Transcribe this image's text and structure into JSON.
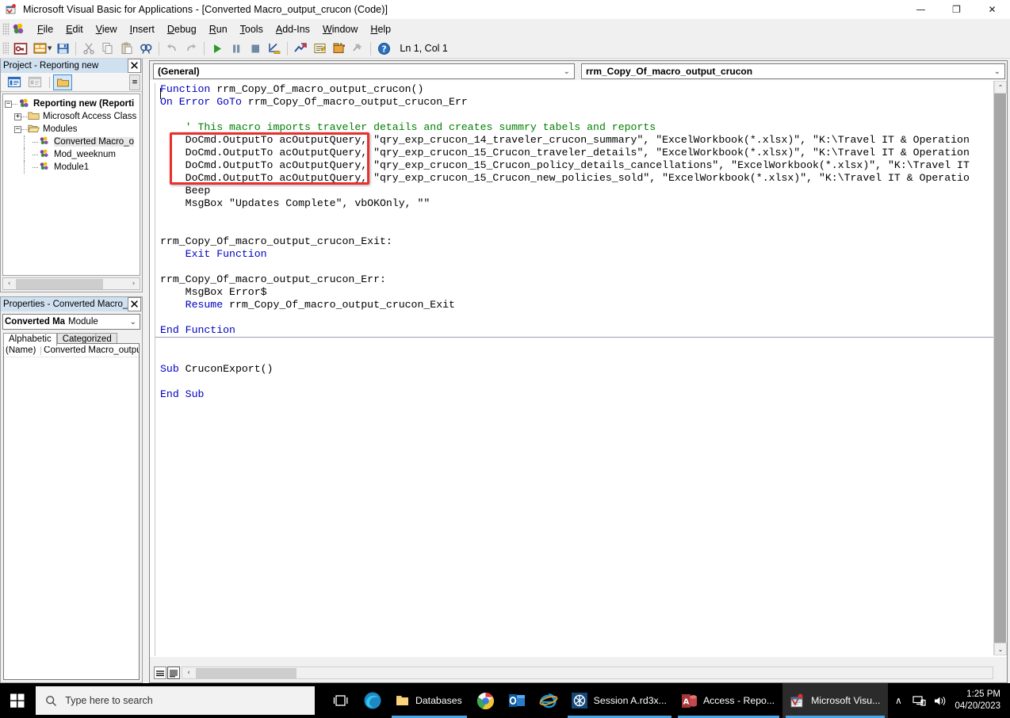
{
  "window": {
    "title": "Microsoft Visual Basic for Applications - [Converted Macro_output_crucon (Code)]",
    "app_icon": "vba-icon",
    "minimize": "—",
    "restore": "❐",
    "close": "✕"
  },
  "mdi": {
    "minimize": "–",
    "restore": "❐",
    "close": "✕"
  },
  "menu": {
    "items": [
      {
        "label": "File",
        "accel": "F"
      },
      {
        "label": "Edit",
        "accel": "E"
      },
      {
        "label": "View",
        "accel": "V"
      },
      {
        "label": "Insert",
        "accel": "I"
      },
      {
        "label": "Debug",
        "accel": "D"
      },
      {
        "label": "Run",
        "accel": "R"
      },
      {
        "label": "Tools",
        "accel": "T"
      },
      {
        "label": "Add-Ins",
        "accel": "A"
      },
      {
        "label": "Window",
        "accel": "W"
      },
      {
        "label": "Help",
        "accel": "H"
      }
    ]
  },
  "toolbar": {
    "buttons": [
      "view-microsoft-access-icon",
      "insert-module-icon",
      "insert-module-dropdown-icon",
      "save-icon",
      "cut-icon",
      "copy-icon",
      "paste-icon",
      "find-icon",
      "undo-icon",
      "redo-icon",
      "run-icon",
      "break-icon",
      "reset-icon",
      "design-mode-icon",
      "project-explorer-icon",
      "properties-window-icon",
      "object-browser-icon",
      "toolbox-icon",
      "help-icon"
    ],
    "status": "Ln 1, Col 1"
  },
  "project_panel": {
    "title": "Project - Reporting new",
    "close_label": "✕",
    "toolbar_buttons": [
      "view-code-icon",
      "view-object-icon",
      "toggle-folders-icon"
    ],
    "overflow_label": "≡",
    "tree": [
      {
        "label": "Reporting new (Reporti",
        "expander": "−",
        "icon": "vba-project-icon",
        "depth": 0,
        "bold": true,
        "selected": false
      },
      {
        "label": "Microsoft Access Class (",
        "expander": "+",
        "icon": "folder-icon",
        "depth": 1,
        "bold": false,
        "selected": false
      },
      {
        "label": "Modules",
        "expander": "−",
        "icon": "open-folder-icon",
        "depth": 1,
        "bold": false,
        "selected": false
      },
      {
        "label": "Converted Macro_o",
        "expander": "",
        "icon": "module-icon",
        "depth": 2,
        "bold": false,
        "selected": true
      },
      {
        "label": "Mod_weeknum",
        "expander": "",
        "icon": "module-icon",
        "depth": 2,
        "bold": false,
        "selected": false
      },
      {
        "label": "Module1",
        "expander": "",
        "icon": "module-icon",
        "depth": 2,
        "bold": false,
        "selected": false
      }
    ],
    "hscroll": {
      "left_arrow": "‹",
      "right_arrow": "›"
    }
  },
  "properties_panel": {
    "title": "Properties - Converted Macro_",
    "close_label": "✕",
    "object_name": "Converted Ma",
    "object_type": "Module",
    "dropdown_arrow": "⌄",
    "tabs": [
      {
        "label": "Alphabetic",
        "active": true
      },
      {
        "label": "Categorized",
        "active": false
      }
    ],
    "rows": [
      {
        "key": "(Name)",
        "value": "Converted Macro_output_"
      }
    ]
  },
  "code_window": {
    "object_combo": "(General)",
    "proc_combo": "rrm_Copy_Of_macro_output_crucon",
    "dropdown_arrow": "⌄",
    "view_buttons": [
      "procedure-view-icon",
      "full-module-view-icon"
    ],
    "hscroll": {
      "left_arrow": "‹",
      "right_arrow": "›"
    },
    "vscroll": {
      "up_arrow": "⌃",
      "down_arrow": "⌄"
    },
    "code_lines": [
      [
        {
          "t": "Function",
          "c": "kw"
        },
        {
          "t": " rrm_Copy_Of_macro_output_crucon()",
          "c": ""
        }
      ],
      [
        {
          "t": "On Error GoTo",
          "c": "kw"
        },
        {
          "t": " rrm_Copy_Of_macro_output_crucon_Err",
          "c": ""
        }
      ],
      [],
      [
        {
          "t": "    ' This macro imports traveler details and creates summry tabels and reports",
          "c": "cmt"
        }
      ],
      [
        {
          "t": "    DoCmd.OutputTo acOutputQuery, \"qry_exp_crucon_14_traveler_crucon_summary\", \"ExcelWorkbook(*.xlsx)\", \"K:\\Travel IT & Operation",
          "c": ""
        }
      ],
      [
        {
          "t": "    DoCmd.OutputTo acOutputQuery, \"qry_exp_crucon_15_Crucon_traveler_details\", \"ExcelWorkbook(*.xlsx)\", \"K:\\Travel IT & Operation",
          "c": ""
        }
      ],
      [
        {
          "t": "    DoCmd.OutputTo acOutputQuery, \"qry_exp_crucon_15_Crucon_policy_details_cancellations\", \"ExcelWorkbook(*.xlsx)\", \"K:\\Travel IT",
          "c": ""
        }
      ],
      [
        {
          "t": "    DoCmd.OutputTo acOutputQuery, \"qry_exp_crucon_15_Crucon_new_policies_sold\", \"ExcelWorkbook(*.xlsx)\", \"K:\\Travel IT & Operatio",
          "c": ""
        }
      ],
      [
        {
          "t": "    Beep",
          "c": ""
        }
      ],
      [
        {
          "t": "    MsgBox \"Updates Complete\", vbOKOnly, \"\"",
          "c": ""
        }
      ],
      [],
      [],
      [
        {
          "t": "rrm_Copy_Of_macro_output_crucon_Exit:",
          "c": ""
        }
      ],
      [
        {
          "t": "    ",
          "c": ""
        },
        {
          "t": "Exit Function",
          "c": "kw"
        }
      ],
      [],
      [
        {
          "t": "rrm_Copy_Of_macro_output_crucon_Err:",
          "c": ""
        }
      ],
      [
        {
          "t": "    MsgBox Error$",
          "c": ""
        }
      ],
      [
        {
          "t": "    ",
          "c": ""
        },
        {
          "t": "Resume",
          "c": "kw"
        },
        {
          "t": " rrm_Copy_Of_macro_output_crucon_Exit",
          "c": ""
        }
      ],
      [],
      [
        {
          "t": "End Function",
          "c": "kw"
        }
      ]
    ],
    "code_lines_2": [
      [],
      [],
      [
        {
          "t": "Sub",
          "c": "kw"
        },
        {
          "t": " CruconExport()",
          "c": ""
        }
      ],
      [],
      [
        {
          "t": "End Sub",
          "c": "kw"
        }
      ]
    ],
    "annotation": {
      "name": "red-highlight-box",
      "color": "#e8312f"
    }
  },
  "taskbar": {
    "start_label": "start-icon",
    "search_placeholder": "Type here to search",
    "search_icon": "search-icon",
    "task_view_icon": "task-view-icon",
    "pinned": [
      {
        "icon": "edge-icon",
        "label": ""
      },
      {
        "icon": "folder-icon",
        "label": "Databases"
      },
      {
        "icon": "chrome-icon",
        "label": ""
      },
      {
        "icon": "outlook-icon",
        "label": ""
      },
      {
        "icon": "internet-explorer-icon",
        "label": ""
      }
    ],
    "windows": [
      {
        "icon": "citrix-icon",
        "label": "Session A.rd3x...",
        "active": false
      },
      {
        "icon": "access-icon",
        "label": "Access - Repo...",
        "active": false
      },
      {
        "icon": "vba-icon",
        "label": "Microsoft Visu...",
        "active": true
      }
    ],
    "tray": {
      "show_hidden": "∧",
      "network_icon": "network-icon",
      "volume_icon": "volume-icon",
      "time": "1:25 PM",
      "date": "04/20/2023"
    }
  }
}
